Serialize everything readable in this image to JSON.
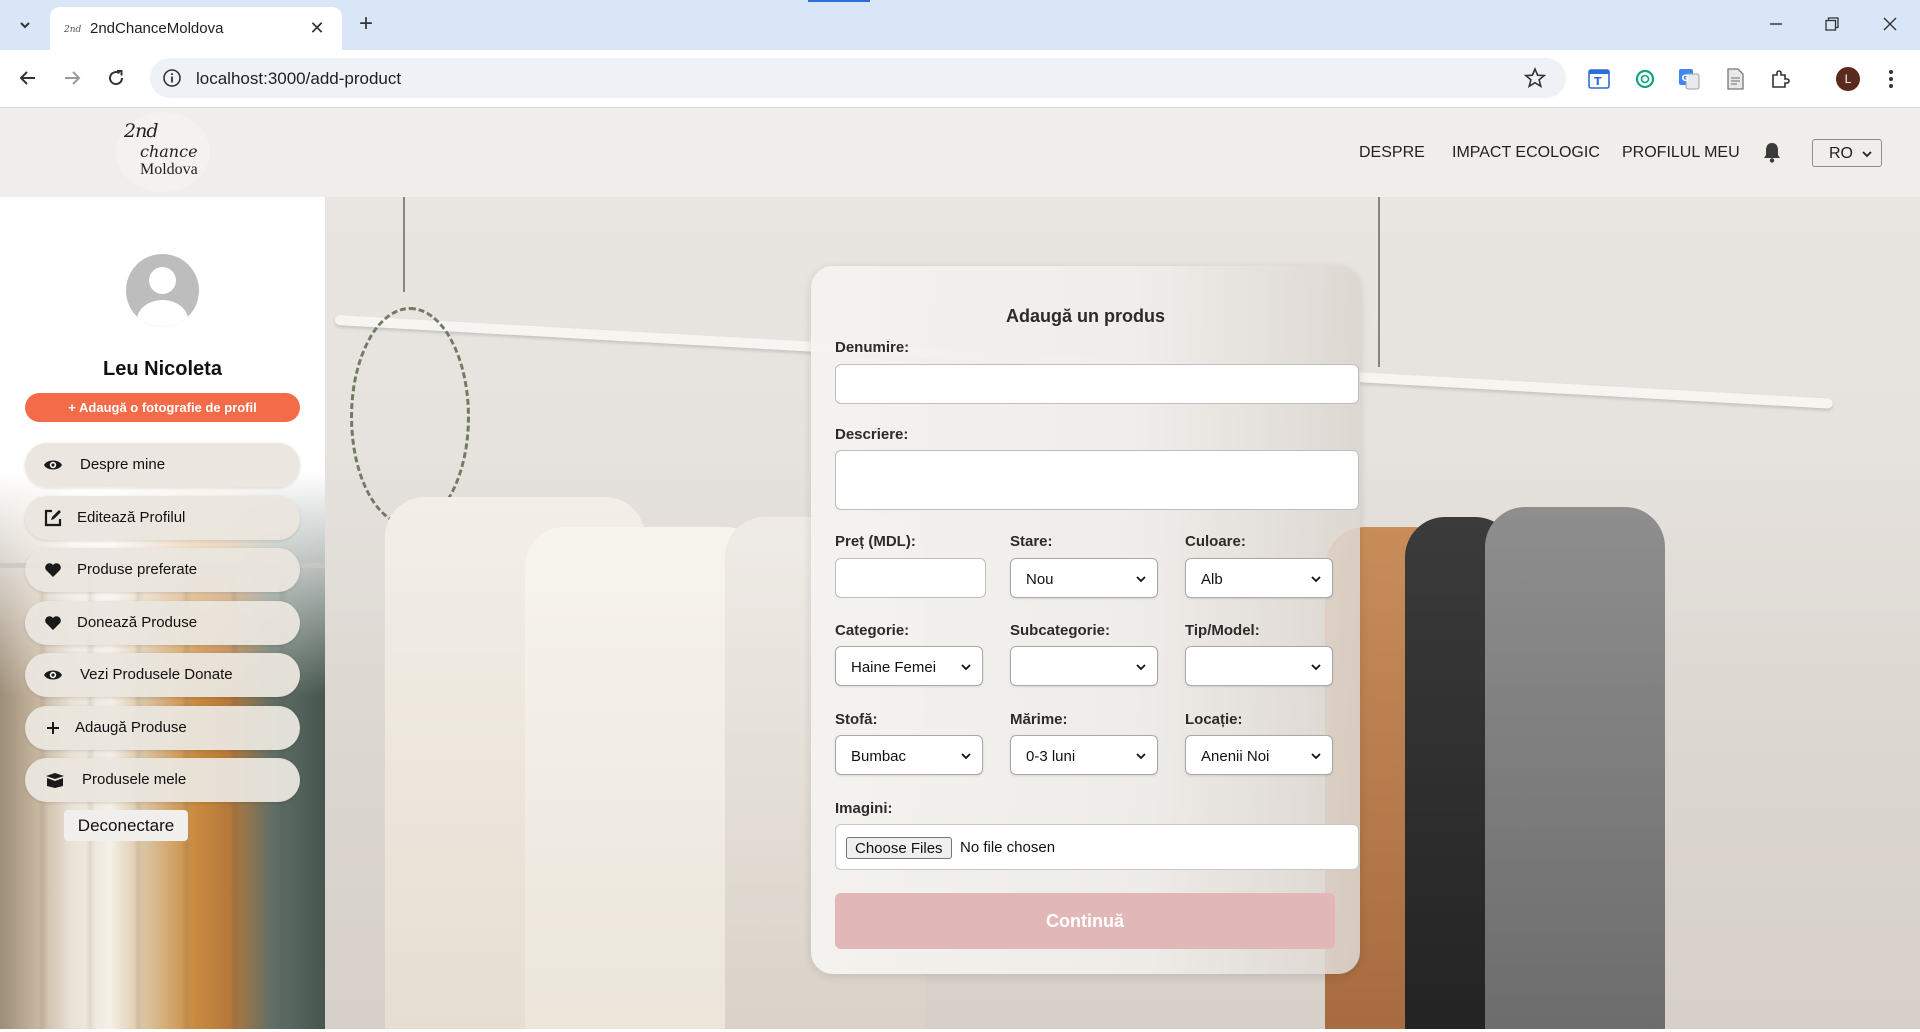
{
  "browser": {
    "tab_title": "2ndChanceMoldova",
    "url": "localhost:3000/add-product",
    "profile_initial": "L"
  },
  "header": {
    "logo": {
      "line1": "2nd",
      "line2": "chance",
      "line3": "Moldova"
    },
    "nav": [
      "DESPRE",
      "IMPACT ECOLOGIC",
      "PROFILUL MEU"
    ],
    "language": "RO"
  },
  "sidebar": {
    "user_name": "Leu Nicoleta",
    "add_photo_label": "+ Adaugă o fotografie de profil",
    "items": [
      {
        "label": "Despre mine",
        "icon": "eye-icon"
      },
      {
        "label": "Editează Profilul",
        "icon": "edit-icon"
      },
      {
        "label": "Produse preferate",
        "icon": "heart-icon"
      },
      {
        "label": "Donează Produse",
        "icon": "heart-icon"
      },
      {
        "label": "Vezi Produsele Donate",
        "icon": "eye-icon"
      },
      {
        "label": "Adaugă Produse",
        "icon": "plus-icon"
      },
      {
        "label": "Produsele mele",
        "icon": "box-icon"
      }
    ],
    "logout_label": "Deconectare"
  },
  "form": {
    "title": "Adaugă un produs",
    "name_label": "Denumire:",
    "name_value": "",
    "description_label": "Descriere:",
    "description_value": "",
    "price_label": "Preț (MDL):",
    "price_value": "",
    "condition_label": "Stare:",
    "condition_value": "Nou",
    "color_label": "Culoare:",
    "color_value": "Alb",
    "category_label": "Categorie:",
    "category_value": "Haine Femei",
    "subcategory_label": "Subcategorie:",
    "subcategory_value": "",
    "type_label": "Tip/Model:",
    "type_value": "",
    "fabric_label": "Stofă:",
    "fabric_value": "Bumbac",
    "size_label": "Mărime:",
    "size_value": "0-3 luni",
    "location_label": "Locație:",
    "location_value": "Anenii Noi",
    "images_label": "Imagini:",
    "choose_files_label": "Choose Files",
    "file_status": "No file chosen",
    "submit_label": "Continuă"
  },
  "colors": {
    "accent": "#f36b49",
    "submit_disabled": "#e2b7b7",
    "header_bg": "#efeeeb"
  }
}
